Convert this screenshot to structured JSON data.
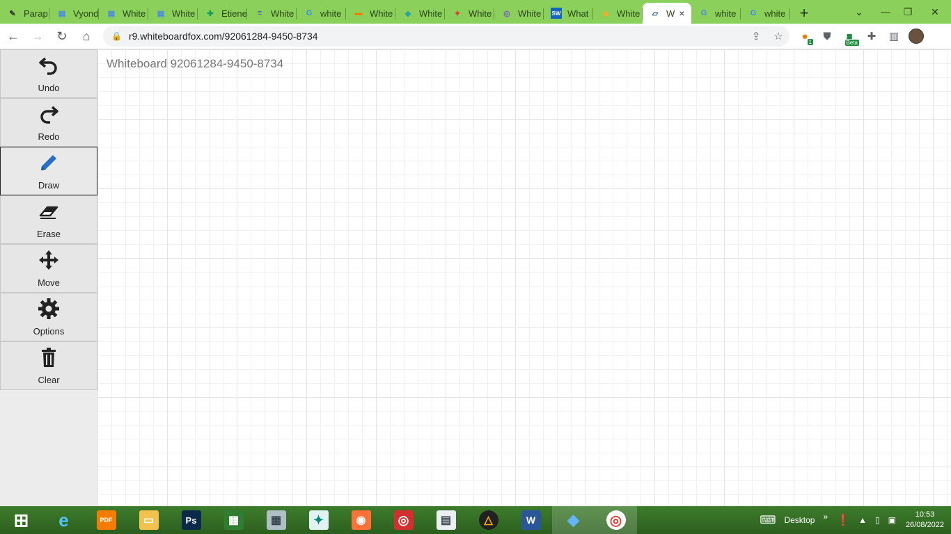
{
  "browser": {
    "tabs": [
      {
        "title": "Parap",
        "icon": "quill-icon",
        "color": "#333333"
      },
      {
        "title": "Vyond",
        "icon": "docs-icon",
        "color": "#4285f4"
      },
      {
        "title": "White",
        "icon": "docs-icon",
        "color": "#4285f4"
      },
      {
        "title": "White",
        "icon": "docs-icon",
        "color": "#4285f4"
      },
      {
        "title": "Etiene",
        "icon": "sheets-icon",
        "color": "#0f9d58"
      },
      {
        "title": "White",
        "icon": "stack-icon",
        "color": "#5b4fc4"
      },
      {
        "title": "white",
        "icon": "google-icon",
        "color": "#4285f4"
      },
      {
        "title": "White",
        "icon": "chat-bubble-icon",
        "color": "#f57c00"
      },
      {
        "title": "White",
        "icon": "wave-icon",
        "color": "#26a69a"
      },
      {
        "title": "White",
        "icon": "pinwheel-icon",
        "color": "#e53935"
      },
      {
        "title": "White",
        "icon": "globe-icon",
        "color": "#7e57c2"
      },
      {
        "title": "What",
        "icon": "sw-icon",
        "color": "#1565c0"
      },
      {
        "title": "White",
        "icon": "diamond-icon",
        "color": "#f9a825"
      },
      {
        "title": "W",
        "icon": "whiteboard-icon",
        "color": "#1e5aa8",
        "active": true
      },
      {
        "title": "white",
        "icon": "google-icon",
        "color": "#4285f4"
      },
      {
        "title": "white",
        "icon": "google-icon",
        "color": "#4285f4"
      }
    ],
    "new_tab": "+",
    "tab_close": "×",
    "url": "r9.whiteboardfox.com/92061284-9450-8734",
    "extension_badge": "1",
    "beta_badge": "Beta"
  },
  "sidebar": {
    "tools": [
      {
        "label": "Undo",
        "icon": "undo-icon"
      },
      {
        "label": "Redo",
        "icon": "redo-icon"
      },
      {
        "label": "Draw",
        "icon": "pencil-icon",
        "selected": true
      },
      {
        "label": "Erase",
        "icon": "eraser-icon"
      },
      {
        "label": "Move",
        "icon": "move-icon"
      },
      {
        "label": "Options",
        "icon": "gear-icon"
      },
      {
        "label": "Clear",
        "icon": "trash-icon"
      }
    ]
  },
  "board": {
    "title": "Whiteboard 92061284-9450-8734"
  },
  "taskbar": {
    "apps": [
      {
        "name": "windows-start-icon"
      },
      {
        "name": "internet-explorer-icon"
      },
      {
        "name": "pdf-app-icon",
        "label": "PDF"
      },
      {
        "name": "file-explorer-icon"
      },
      {
        "name": "photoshop-icon",
        "label": "Ps"
      },
      {
        "name": "store-icon"
      },
      {
        "name": "calculator-icon"
      },
      {
        "name": "xmind-icon"
      },
      {
        "name": "firefox-icon"
      },
      {
        "name": "target-app-icon"
      },
      {
        "name": "reader-app-icon"
      },
      {
        "name": "triangle-app-icon"
      },
      {
        "name": "word-icon",
        "label": "W"
      },
      {
        "name": "cloud-app-icon"
      },
      {
        "name": "chrome-icon"
      }
    ],
    "desktop_label": "Desktop",
    "chevron": "»",
    "time": "10:53",
    "date": "26/08/2022"
  }
}
